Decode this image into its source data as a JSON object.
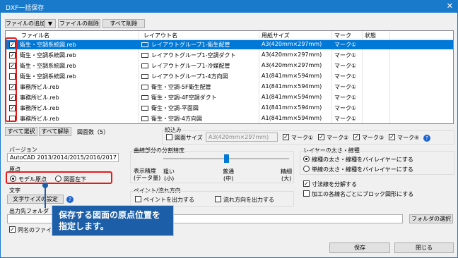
{
  "window": {
    "title": "DXF一括保存",
    "close_glyph": "✕"
  },
  "toolbar": {
    "add_label": "ファイルの追加",
    "dropdown_glyph": "▼",
    "delete_label": "ファイルの削除",
    "delete_all_label": "すべて削除"
  },
  "table": {
    "columns": [
      "ファイル名",
      "レイアウト名",
      "用紙サイズ",
      "マーク",
      "状態"
    ],
    "rows": [
      {
        "checked": true,
        "file": "衛生・空調系統図.reb",
        "layout": "レイアウトグループ1-衛生配管",
        "paper": "A3(420mm×297mm)",
        "mark": "マーク①",
        "selected": true
      },
      {
        "checked": true,
        "file": "衛生・空調系統図.reb",
        "layout": "レイアウトグループ1-空調ダクト",
        "paper": "A3(420mm×297mm)",
        "mark": "マーク①",
        "selected": false
      },
      {
        "checked": true,
        "file": "衛生・空調系統図.reb",
        "layout": "レイアウトグループ1-冷媒配管",
        "paper": "A3(420mm×297mm)",
        "mark": "マーク①",
        "selected": false
      },
      {
        "checked": false,
        "file": "衛生・空調系統図.reb",
        "layout": "レイアウトグループ1-4方向図",
        "paper": "A1(841mm×594mm)",
        "mark": "マーク①",
        "selected": false
      },
      {
        "checked": true,
        "file": "事務所ビル.reb",
        "layout": "衛生・空調-5F衛生配管",
        "paper": "A1(841mm×594mm)",
        "mark": "マーク①",
        "selected": false
      },
      {
        "checked": true,
        "file": "事務所ビル.reb",
        "layout": "衛生・空調-4F空調ダクト",
        "paper": "A1(841mm×594mm)",
        "mark": "マーク①",
        "selected": false
      },
      {
        "checked": true,
        "file": "事務所ビル.reb",
        "layout": "衛生・空調-平面図",
        "paper": "A1(841mm×594mm)",
        "mark": "マーク①",
        "selected": false
      },
      {
        "checked": false,
        "file": "事務所ビル.reb",
        "layout": "衛生・空調-4方向図",
        "paper": "A1(841mm×594mm)",
        "mark": "マーク①",
        "selected": false
      }
    ]
  },
  "selection": {
    "select_all": "すべて選択",
    "clear_all": "すべて解除",
    "count_label": "図面数（5）"
  },
  "filter": {
    "title": "絞込み",
    "paper_label": "図面サイズ",
    "paper_value": "A3(420mm×297mm)",
    "marks": [
      "マーク①",
      "マーク②",
      "マーク③",
      "マーク④"
    ]
  },
  "version": {
    "title": "バージョン",
    "value": "AutoCAD 2013/2014/2015/2016/2017"
  },
  "origin": {
    "title": "原点",
    "model_label": "モデル原点",
    "paper_label": "図面左下"
  },
  "text": {
    "title": "文字",
    "size_button": "文字サイズの設定"
  },
  "curve": {
    "title": "曲線部分の分割精度",
    "left_label": "表示精度\n(データ量)",
    "ticks": [
      "粗い",
      "普通",
      "精細"
    ],
    "subticks": [
      "(小)",
      "(中)",
      "(大)"
    ],
    "slider_level": 0.5
  },
  "paint": {
    "title": "ペイント/流れ方向",
    "paint_label": "ペイントを出力する",
    "flow_label": "流れ方向を出力する"
  },
  "layer": {
    "title": "レイヤーの太さ・線種",
    "opt1": "線種の太さ・線種をバイレイヤーにする",
    "opt2": "単線の太さ・線種をバイレイヤーにする",
    "dim_label": "寸法線を分解する",
    "block_label": "加工の各線名ごとにブロック図形にする"
  },
  "output": {
    "title": "出力先フォルダ",
    "browse": "フォルダの選択",
    "same_name_label": "同名のファイル"
  },
  "actions": {
    "save": "保存",
    "close": "閉じる"
  },
  "callout": {
    "line1": "保存する図面の原点位置を",
    "line2": "指定します。"
  },
  "colors": {
    "accent": "#1979ca",
    "highlight": "#e41b1b",
    "callout": "#1c5ea8"
  }
}
